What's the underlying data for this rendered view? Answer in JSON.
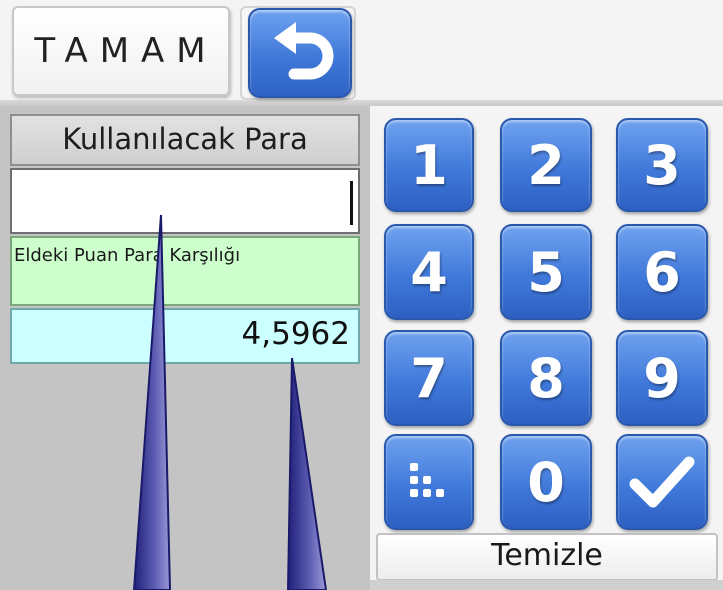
{
  "toolbar": {
    "ok_label": "TAMAM"
  },
  "form": {
    "header_label": "Kullanılacak Para",
    "amount_value": "",
    "points_label": "Eldeki Puan Para Karşılığı",
    "points_value": "4,5962"
  },
  "keypad": {
    "digits": [
      "1",
      "2",
      "3",
      "4",
      "5",
      "6",
      "7",
      "8",
      "9",
      "0"
    ],
    "clear_label": "Temizle"
  },
  "icons": {
    "back": "undo-arrow-icon",
    "decimal": "decimal-point-icon",
    "confirm": "checkmark-icon"
  },
  "colors": {
    "key_blue": "#3f78d8",
    "green_field": "#ccffcc",
    "cyan_field": "#ccffff",
    "panel_gray": "#c4c4c4",
    "pointer_navy": "#20207a"
  }
}
